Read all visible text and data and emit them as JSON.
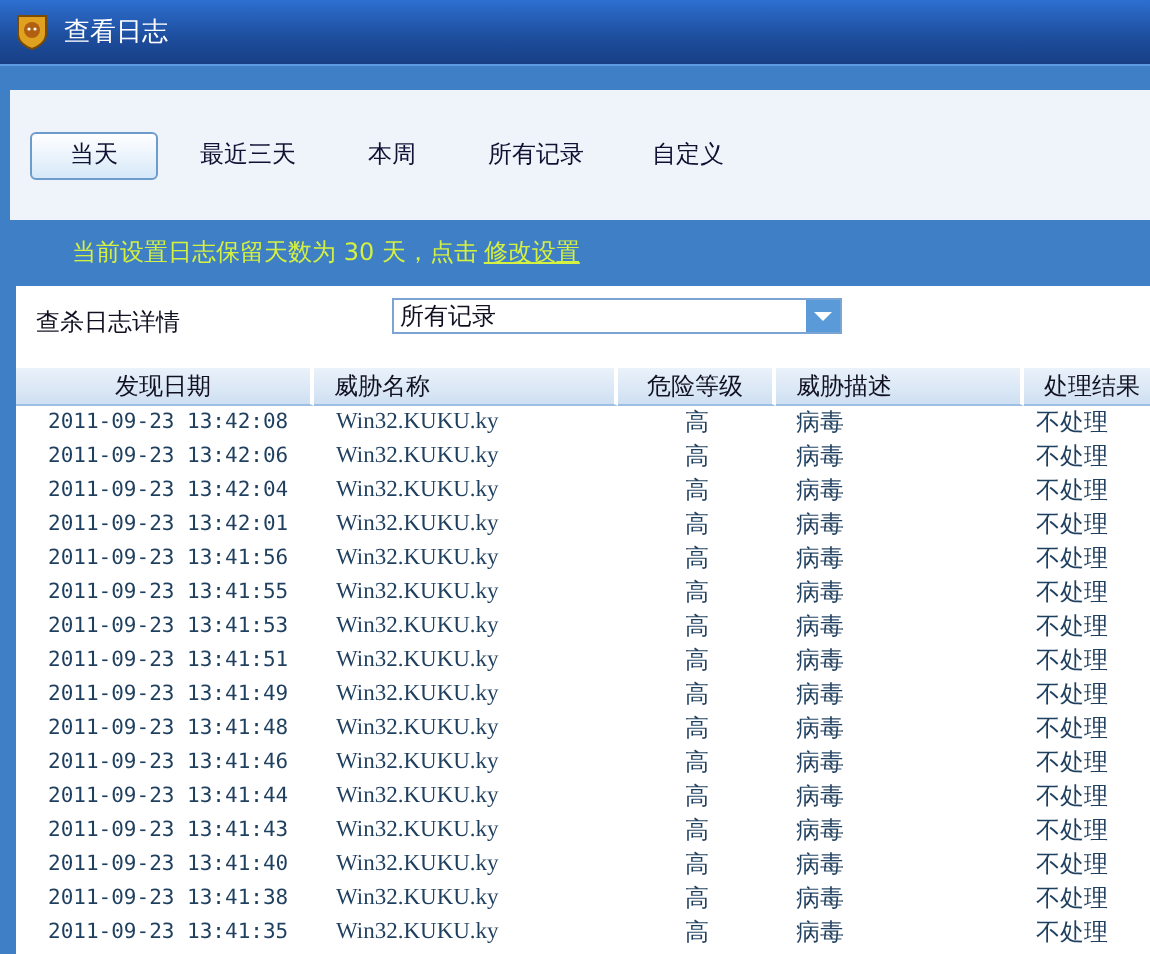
{
  "window": {
    "title": "查看日志"
  },
  "tabs": [
    {
      "label": "当天",
      "selected": true
    },
    {
      "label": "最近三天",
      "selected": false
    },
    {
      "label": "本周",
      "selected": false
    },
    {
      "label": "所有记录",
      "selected": false
    },
    {
      "label": "自定义",
      "selected": false
    }
  ],
  "notice": {
    "text": "当前设置日志保留天数为 30 天，点击",
    "link": "修改设置"
  },
  "filter": {
    "label": "查杀日志详情",
    "value": "所有记录"
  },
  "table": {
    "columns": [
      "发现日期",
      "威胁名称",
      "危险等级",
      "威胁描述",
      "处理结果"
    ],
    "rows": [
      [
        "2011-09-23 13:42:08",
        "Win32.KUKU.ky",
        "高",
        "病毒",
        "不处理"
      ],
      [
        "2011-09-23 13:42:06",
        "Win32.KUKU.ky",
        "高",
        "病毒",
        "不处理"
      ],
      [
        "2011-09-23 13:42:04",
        "Win32.KUKU.ky",
        "高",
        "病毒",
        "不处理"
      ],
      [
        "2011-09-23 13:42:01",
        "Win32.KUKU.ky",
        "高",
        "病毒",
        "不处理"
      ],
      [
        "2011-09-23 13:41:56",
        "Win32.KUKU.ky",
        "高",
        "病毒",
        "不处理"
      ],
      [
        "2011-09-23 13:41:55",
        "Win32.KUKU.ky",
        "高",
        "病毒",
        "不处理"
      ],
      [
        "2011-09-23 13:41:53",
        "Win32.KUKU.ky",
        "高",
        "病毒",
        "不处理"
      ],
      [
        "2011-09-23 13:41:51",
        "Win32.KUKU.ky",
        "高",
        "病毒",
        "不处理"
      ],
      [
        "2011-09-23 13:41:49",
        "Win32.KUKU.ky",
        "高",
        "病毒",
        "不处理"
      ],
      [
        "2011-09-23 13:41:48",
        "Win32.KUKU.ky",
        "高",
        "病毒",
        "不处理"
      ],
      [
        "2011-09-23 13:41:46",
        "Win32.KUKU.ky",
        "高",
        "病毒",
        "不处理"
      ],
      [
        "2011-09-23 13:41:44",
        "Win32.KUKU.ky",
        "高",
        "病毒",
        "不处理"
      ],
      [
        "2011-09-23 13:41:43",
        "Win32.KUKU.ky",
        "高",
        "病毒",
        "不处理"
      ],
      [
        "2011-09-23 13:41:40",
        "Win32.KUKU.ky",
        "高",
        "病毒",
        "不处理"
      ],
      [
        "2011-09-23 13:41:38",
        "Win32.KUKU.ky",
        "高",
        "病毒",
        "不处理"
      ],
      [
        "2011-09-23 13:41:35",
        "Win32.KUKU.ky",
        "高",
        "病毒",
        "不处理"
      ]
    ]
  }
}
